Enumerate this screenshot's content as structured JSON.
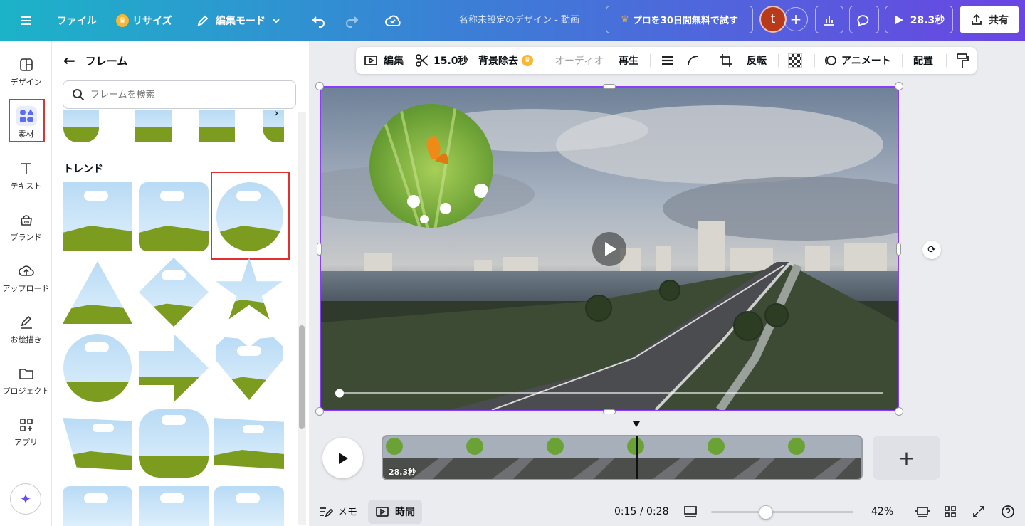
{
  "topbar": {
    "menu_icon": "hamburger-icon",
    "file_label": "ファイル",
    "resize_label": "リサイズ",
    "edit_mode_label": "編集モード",
    "doc_title": "名称未設定のデザイン - 動画",
    "pro_trial_label": "プロを30日間無料で試す",
    "avatar_initial": "t",
    "play_duration": "28.3秒",
    "share_label": "共有",
    "accent_color": "#6a45e3"
  },
  "rail": {
    "items": [
      {
        "label": "デザイン",
        "icon": "layout-icon"
      },
      {
        "label": "素材",
        "icon": "elements-icon"
      },
      {
        "label": "テキスト",
        "icon": "text-icon"
      },
      {
        "label": "ブランド",
        "icon": "brand-icon"
      },
      {
        "label": "アップロード",
        "icon": "upload-icon"
      },
      {
        "label": "お絵描き",
        "icon": "draw-icon"
      },
      {
        "label": "プロジェクト",
        "icon": "folder-icon"
      },
      {
        "label": "アプリ",
        "icon": "apps-icon"
      }
    ]
  },
  "panel": {
    "title": "フレーム",
    "search_placeholder": "フレームを検索",
    "section_trend": "トレンド"
  },
  "context_toolbar": {
    "edit": "編集",
    "duration": "15.0秒",
    "bg_remove": "背景除去",
    "audio": "オーディオ",
    "playback": "再生",
    "flip": "反転",
    "animate": "アニメート",
    "position": "配置"
  },
  "timeline": {
    "clip_duration": "28.3秒",
    "add_label": "+"
  },
  "bottombar": {
    "notes": "メモ",
    "timer": "時間",
    "time_readout": "0:15 / 0:28",
    "zoom": "42%",
    "zoom_value": 0.42
  }
}
